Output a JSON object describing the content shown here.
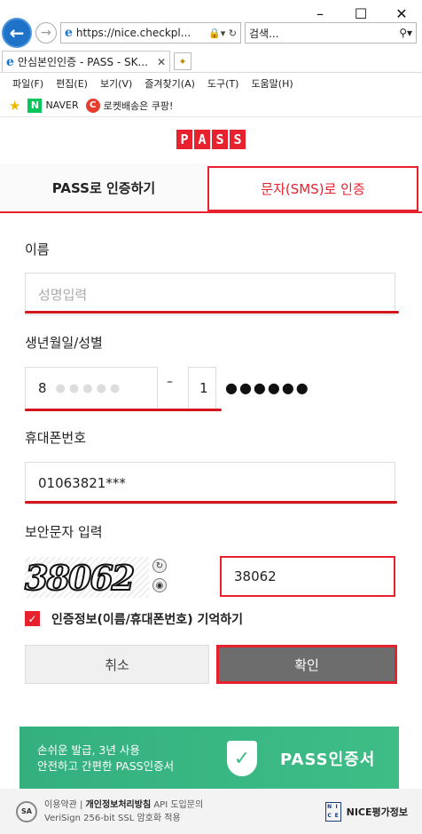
{
  "browser": {
    "window_buttons": [
      "–",
      "☐",
      "✕"
    ],
    "url": "https://nice.checkpl...",
    "search_placeholder": "검색...",
    "tab_title": "안심본인인증 - PASS - SK...",
    "menu": [
      "파일(F)",
      "편집(E)",
      "보기(V)",
      "즐겨찾기(A)",
      "도구(T)",
      "도움말(H)"
    ],
    "favorites": [
      {
        "label": "NAVER",
        "icon": "naver-icon"
      },
      {
        "label": "로켓배송은 쿠팡!",
        "icon": "coupang-icon"
      }
    ]
  },
  "page": {
    "logo_letters": [
      "P",
      "A",
      "S",
      "S"
    ],
    "tabs": [
      {
        "label": "PASS로 인증하기",
        "active": false
      },
      {
        "label": "문자(SMS)로 인증",
        "active": true
      }
    ],
    "name": {
      "label": "이름",
      "placeholder": "성명입력"
    },
    "birth": {
      "label": "생년월일/성별",
      "first_digit": "8",
      "dash": "–",
      "gender_digit": "1",
      "masked": "●●●●●●"
    },
    "phone": {
      "label": "휴대폰번호",
      "value": "01063821***"
    },
    "captcha": {
      "label": "보안문자 입력",
      "image_text": "38062",
      "input_value": "38062"
    },
    "remember": {
      "label": "인증정보(이름/휴대폰번호) 기억하기",
      "checked": true
    },
    "buttons": {
      "cancel": "취소",
      "confirm": "확인"
    },
    "banner": {
      "line1": "손쉬운 발급, 3년 사용",
      "line2": "안전하고 간편한 PASS인증서",
      "brand": "PASS인증서"
    },
    "footer": {
      "terms": "이용약관",
      "privacy": "개인정보처리방침",
      "api": "API 도입문의",
      "ssl": "VeriSign 256-bit SSL 암호화 적용",
      "company": "NICE평가정보"
    }
  },
  "colors": {
    "accent": "#e8212e",
    "banner": "#3fbd87",
    "confirm_bg": "#6d6d6d"
  }
}
